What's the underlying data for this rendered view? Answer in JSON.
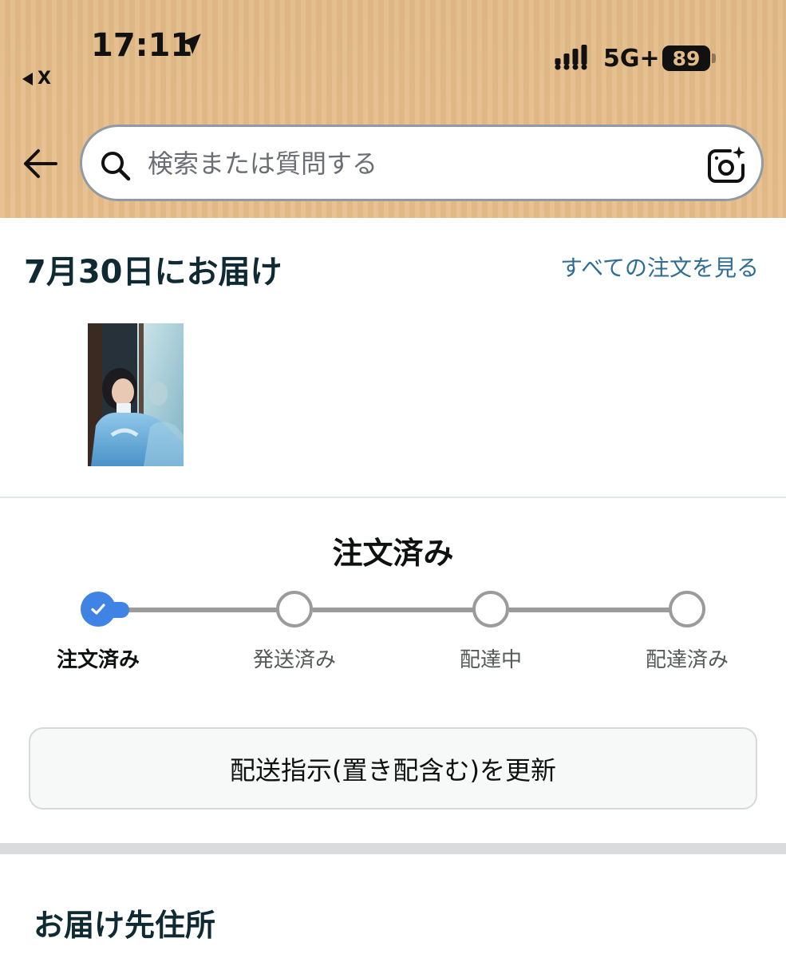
{
  "status_bar": {
    "time": "17:11",
    "back_app": "X",
    "network": "5G+",
    "battery": "89"
  },
  "search": {
    "placeholder": "検索または質問する"
  },
  "delivery": {
    "title": "7月30日にお届け",
    "all_orders_link": "すべての注文を見る"
  },
  "order_status": {
    "heading": "注文済み",
    "current_step_index": 0,
    "steps": [
      {
        "label": "注文済み",
        "done": true
      },
      {
        "label": "発送済み",
        "done": false
      },
      {
        "label": "配達中",
        "done": false
      },
      {
        "label": "配達済み",
        "done": false
      }
    ]
  },
  "actions": {
    "update_delivery": "配送指示(置き配含む)を更新"
  },
  "address_section": {
    "title": "お届け先住所"
  },
  "colors": {
    "header_bg": "#e2ba86",
    "accent_blue": "#3f84e5",
    "link": "#2f6d95",
    "track_gray": "#9b9b9b"
  },
  "icons": {
    "back": "arrow-left-icon",
    "search": "search-icon",
    "camera": "camera-sparkle-icon",
    "location": "location-arrow-icon",
    "check": "check-icon"
  }
}
